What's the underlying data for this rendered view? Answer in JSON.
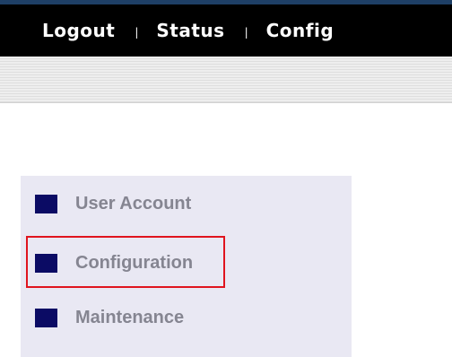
{
  "colors": {
    "topbar_background": "#000000",
    "top_accent": "#1e3f66",
    "menu_panel_background": "#e9e8f3",
    "menu_bullet": "#0b0b64",
    "menu_text": "#858591",
    "highlight_border": "#e0141e"
  },
  "topnav": {
    "separator": "|",
    "items": [
      {
        "label": "Logout"
      },
      {
        "label": "Status"
      },
      {
        "label": "Config"
      }
    ]
  },
  "menu": {
    "highlighted_item": "Configuration",
    "items": [
      {
        "label": "User Account",
        "icon": "square-bullet-icon"
      },
      {
        "label": "Configuration",
        "icon": "square-bullet-icon"
      },
      {
        "label": "Maintenance",
        "icon": "square-bullet-icon"
      }
    ]
  }
}
